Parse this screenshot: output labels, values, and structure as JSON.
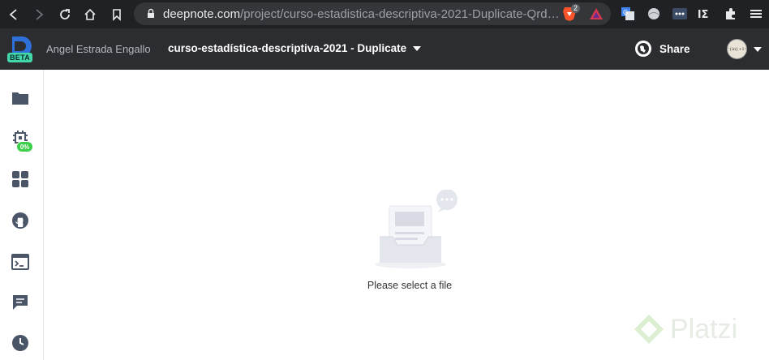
{
  "browser": {
    "url_host": "deepnote.com",
    "url_path": "/project/curso-estadistica-descriptiva-2021-Duplicate-Qrd…",
    "brave_badge_count": "2"
  },
  "header": {
    "beta_label": "BETA",
    "owner": "Angel Estrada Engallo",
    "project_title": "curso-estadística-descriptiva-2021 - Duplicate",
    "share_label": "Share",
    "avatar_text": "e^{iπ}+1=0"
  },
  "sidebar": {
    "items": [
      {
        "name": "files",
        "icon": "folder-icon"
      },
      {
        "name": "machine",
        "icon": "chip-icon",
        "badge": "0%"
      },
      {
        "name": "integrations",
        "icon": "apps-icon"
      },
      {
        "name": "github",
        "icon": "github-icon"
      },
      {
        "name": "terminal",
        "icon": "terminal-icon"
      },
      {
        "name": "comments",
        "icon": "comment-icon"
      },
      {
        "name": "history",
        "icon": "clock-icon"
      }
    ]
  },
  "main": {
    "empty_message": "Please select a file"
  },
  "watermark": {
    "text": "Platzi"
  },
  "colors": {
    "browser_bg": "#202124",
    "header_bg": "#2b2d31",
    "sidebar_icon": "#4a5568",
    "badge_green": "#3dcf4a",
    "beta_green": "#42d8a7"
  }
}
